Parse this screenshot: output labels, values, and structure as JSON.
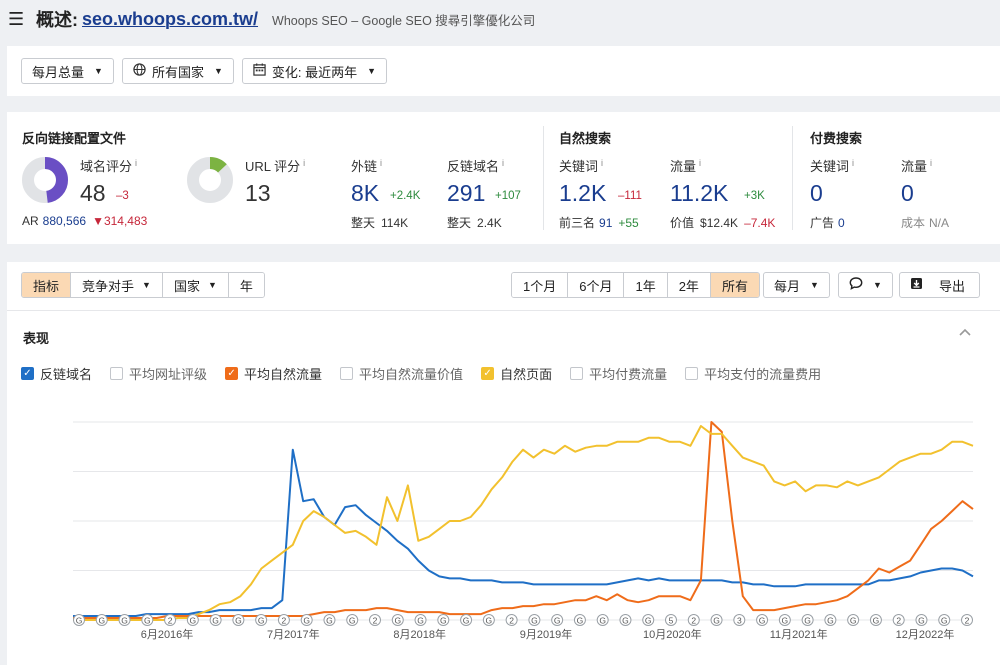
{
  "header": {
    "menu_icon": "hamburger-menu-icon",
    "title_prefix": "概述:",
    "domain": "seo.whoops.com.tw/",
    "subtitle": "Whoops SEO – Google SEO 搜尋引擎優化公司"
  },
  "filters": {
    "volume": "每月总量",
    "country": "所有国家",
    "change": "变化: 最近两年"
  },
  "backlink_profile": {
    "title": "反向链接配置文件",
    "dr": {
      "label": "域名评分",
      "value": "48",
      "change": "–3"
    },
    "ar": {
      "label": "AR",
      "value": "880,566",
      "change": "314,483"
    },
    "ur": {
      "label": "URL 评分",
      "value": "13"
    },
    "backlinks": {
      "label": "外链",
      "value": "8K",
      "change": "+2.4K",
      "sub_label": "整天",
      "sub_value": "114K"
    },
    "ref_domains": {
      "label": "反链域名",
      "value": "291",
      "change": "+107",
      "sub_label": "整天",
      "sub_value": "2.4K"
    }
  },
  "organic": {
    "title": "自然搜索",
    "keywords": {
      "label": "关键词",
      "value": "1.2K",
      "change": "–111",
      "sub_label": "前三名",
      "sub_value": "91",
      "sub_change": "+55"
    },
    "traffic": {
      "label": "流量",
      "value": "11.2K",
      "change": "+3K",
      "sub_label": "价值",
      "sub_value": "$12.4K",
      "sub_change": "–7.4K"
    }
  },
  "paid": {
    "title": "付费搜索",
    "keywords": {
      "label": "关键词",
      "value": "0",
      "sub_label": "广告",
      "sub_value": "0"
    },
    "traffic": {
      "label": "流量",
      "value": "0",
      "sub_label": "成本",
      "sub_value": "N/A"
    }
  },
  "toolbar": {
    "left": [
      "指标",
      "竞争对手",
      "国家",
      "年"
    ],
    "ranges": [
      "1个月",
      "6个月",
      "1年",
      "2年",
      "所有"
    ],
    "interval": "每月",
    "export": "导出"
  },
  "section_title": "表现",
  "legend": [
    {
      "label": "反链域名",
      "checked": true,
      "color": "#1f6fc6"
    },
    {
      "label": "平均网址评级",
      "checked": false,
      "color": ""
    },
    {
      "label": "平均自然流量",
      "checked": true,
      "color": "#ef6c1a"
    },
    {
      "label": "平均自然流量价值",
      "checked": false,
      "color": ""
    },
    {
      "label": "自然页面",
      "checked": true,
      "color": "#f2c12e"
    },
    {
      "label": "平均付费流量",
      "checked": false,
      "color": ""
    },
    {
      "label": "平均支付的流量费用",
      "checked": false,
      "color": ""
    }
  ],
  "chart_data": {
    "type": "line",
    "x_tick_labels": [
      "6月2016年",
      "7月2017年",
      "8月2018年",
      "9月2019年",
      "10月2020年",
      "11月2021年",
      "12月2022年"
    ],
    "grid": true,
    "series": [
      {
        "name": "反链域名",
        "color": "#1f6fc6",
        "values": [
          0.02,
          0.02,
          0.02,
          0.02,
          0.02,
          0.02,
          0.02,
          0.03,
          0.03,
          0.03,
          0.03,
          0.03,
          0.04,
          0.04,
          0.05,
          0.05,
          0.05,
          0.05,
          0.06,
          0.06,
          0.1,
          0.86,
          0.6,
          0.61,
          0.52,
          0.48,
          0.57,
          0.58,
          0.53,
          0.49,
          0.45,
          0.4,
          0.36,
          0.3,
          0.25,
          0.22,
          0.21,
          0.21,
          0.2,
          0.2,
          0.2,
          0.19,
          0.19,
          0.19,
          0.18,
          0.18,
          0.18,
          0.18,
          0.18,
          0.18,
          0.18,
          0.18,
          0.19,
          0.2,
          0.21,
          0.2,
          0.21,
          0.2,
          0.2,
          0.2,
          0.2,
          0.2,
          0.2,
          0.19,
          0.19,
          0.18,
          0.18,
          0.17,
          0.17,
          0.17,
          0.18,
          0.18,
          0.18,
          0.18,
          0.18,
          0.18,
          0.18,
          0.2,
          0.2,
          0.21,
          0.22,
          0.24,
          0.25,
          0.26,
          0.26,
          0.25,
          0.22
        ]
      },
      {
        "name": "平均自然流量",
        "color": "#ef6c1a",
        "values": [
          0.01,
          0.01,
          0.01,
          0.01,
          0.01,
          0.01,
          0.01,
          0.01,
          0.01,
          0.02,
          0.02,
          0.02,
          0.02,
          0.02,
          0.02,
          0.02,
          0.02,
          0.02,
          0.02,
          0.02,
          0.02,
          0.02,
          0.02,
          0.03,
          0.04,
          0.04,
          0.05,
          0.05,
          0.05,
          0.06,
          0.06,
          0.05,
          0.04,
          0.04,
          0.04,
          0.04,
          0.03,
          0.03,
          0.03,
          0.03,
          0.05,
          0.06,
          0.06,
          0.07,
          0.07,
          0.08,
          0.08,
          0.09,
          0.1,
          0.1,
          0.12,
          0.1,
          0.13,
          0.1,
          0.09,
          0.1,
          0.12,
          0.12,
          0.12,
          0.1,
          0.2,
          1.0,
          0.95,
          0.5,
          0.12,
          0.05,
          0.05,
          0.05,
          0.06,
          0.07,
          0.08,
          0.08,
          0.09,
          0.1,
          0.12,
          0.16,
          0.2,
          0.26,
          0.24,
          0.27,
          0.3,
          0.38,
          0.46,
          0.5,
          0.55,
          0.6,
          0.56
        ]
      },
      {
        "name": "自然页面",
        "color": "#f2c12e",
        "values": [
          0.0,
          0.0,
          0.0,
          0.0,
          0.0,
          0.0,
          0.0,
          0.0,
          0.0,
          0.0,
          0.01,
          0.01,
          0.03,
          0.05,
          0.08,
          0.09,
          0.12,
          0.18,
          0.26,
          0.3,
          0.34,
          0.38,
          0.5,
          0.55,
          0.52,
          0.48,
          0.44,
          0.45,
          0.42,
          0.38,
          0.62,
          0.5,
          0.68,
          0.4,
          0.42,
          0.46,
          0.5,
          0.5,
          0.52,
          0.58,
          0.66,
          0.72,
          0.8,
          0.86,
          0.82,
          0.86,
          0.84,
          0.88,
          0.85,
          0.87,
          0.88,
          0.88,
          0.9,
          0.9,
          0.9,
          0.92,
          0.92,
          0.9,
          0.9,
          0.88,
          0.98,
          0.94,
          0.94,
          0.88,
          0.82,
          0.8,
          0.78,
          0.7,
          0.68,
          0.7,
          0.65,
          0.68,
          0.68,
          0.67,
          0.7,
          0.68,
          0.7,
          0.72,
          0.76,
          0.8,
          0.82,
          0.84,
          0.84,
          0.86,
          0.9,
          0.9,
          0.88
        ]
      }
    ],
    "annotation_markers": [
      "G",
      "G",
      "G",
      "G",
      "2",
      "G",
      "G",
      "G",
      "G",
      "2",
      "G",
      "G",
      "G",
      "2",
      "G",
      "G",
      "G",
      "G",
      "G",
      "2",
      "G",
      "G",
      "G",
      "G",
      "G",
      "G",
      "5",
      "2",
      "G",
      "3",
      "G",
      "G",
      "G",
      "G",
      "G",
      "G",
      "2",
      "G",
      "G",
      "2"
    ]
  }
}
